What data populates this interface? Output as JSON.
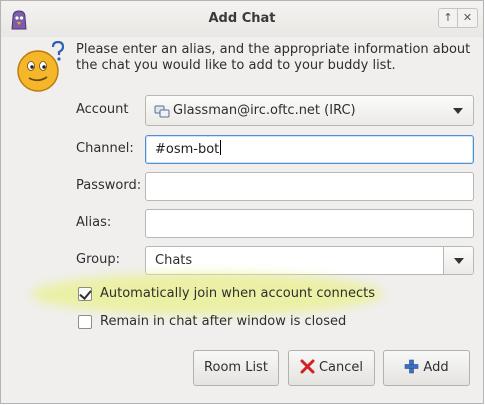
{
  "window": {
    "title": "Add Chat"
  },
  "intro": "Please enter an alias, and the appropriate information about the chat you would like to add to your buddy list.",
  "form": {
    "account": {
      "label": "Account",
      "value": "Glassman@irc.oftc.net (IRC)"
    },
    "channel": {
      "label": "Channel:",
      "value": "#osm-bot"
    },
    "password": {
      "label": "Password:",
      "value": ""
    },
    "alias": {
      "label": "Alias:",
      "value": ""
    },
    "group": {
      "label": "Group:",
      "value": "Chats"
    }
  },
  "options": {
    "auto_join": {
      "label": "Automatically join when account connects",
      "checked": true
    },
    "remain": {
      "label": "Remain in chat after window is closed",
      "checked": false
    }
  },
  "buttons": {
    "room_list": "Room List",
    "cancel": "Cancel",
    "add": "Add"
  },
  "icons": {
    "app": "pidgin-icon",
    "window_up": "arrow-up-icon",
    "window_close": "close-icon",
    "dialog": "smiley-question-icon",
    "account_protocol": "irc-protocol-icon",
    "cancel": "cancel-x-icon",
    "add": "plus-icon"
  },
  "colors": {
    "focus": "#4a90d9",
    "highlight": "#e9f08c"
  }
}
